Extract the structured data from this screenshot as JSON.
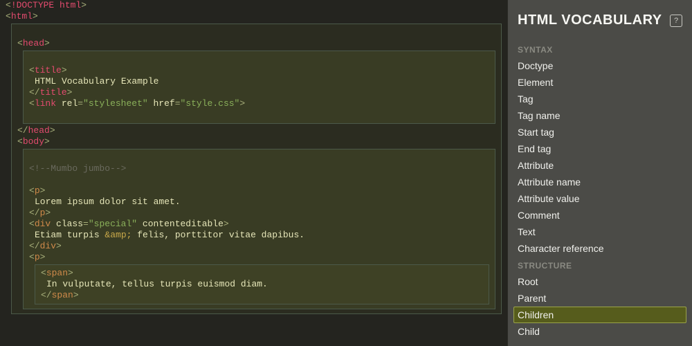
{
  "sidebar": {
    "title": "HTML VOCABULARY",
    "help": "?",
    "sections": [
      {
        "label": "SYNTAX",
        "items": [
          "Doctype",
          "Element",
          "Tag",
          "Tag name",
          "Start tag",
          "End tag",
          "Attribute",
          "Attribute name",
          "Attribute value",
          "Comment",
          "Text",
          "Character reference"
        ]
      },
      {
        "label": "STRUCTURE",
        "items": [
          "Root",
          "Parent",
          "Children",
          "Child"
        ]
      }
    ],
    "selected": "Children"
  },
  "code": {
    "doctype_kw": "!DOCTYPE",
    "doctype_id": "html",
    "html": "html",
    "head": "head",
    "title": "title",
    "title_text": "HTML Vocabulary Example",
    "link": "link",
    "rel_attr": "rel",
    "rel_val": "\"stylesheet\"",
    "href_attr": "href",
    "href_val": "\"style.css\"",
    "body": "body",
    "comment": "<!--Mumbo jumbo-->",
    "p": "p",
    "p1_text": "Lorem ipsum dolor sit amet.",
    "div": "div",
    "class_attr": "class",
    "class_val": "\"special\"",
    "contenteditable": "contenteditable",
    "div_text_a": "Etiam turpis ",
    "amp": "&amp;",
    "div_text_b": " felis, porttitor vitae dapibus.",
    "span": "span",
    "span_text": "In vulputate, tellus turpis euismod diam."
  }
}
